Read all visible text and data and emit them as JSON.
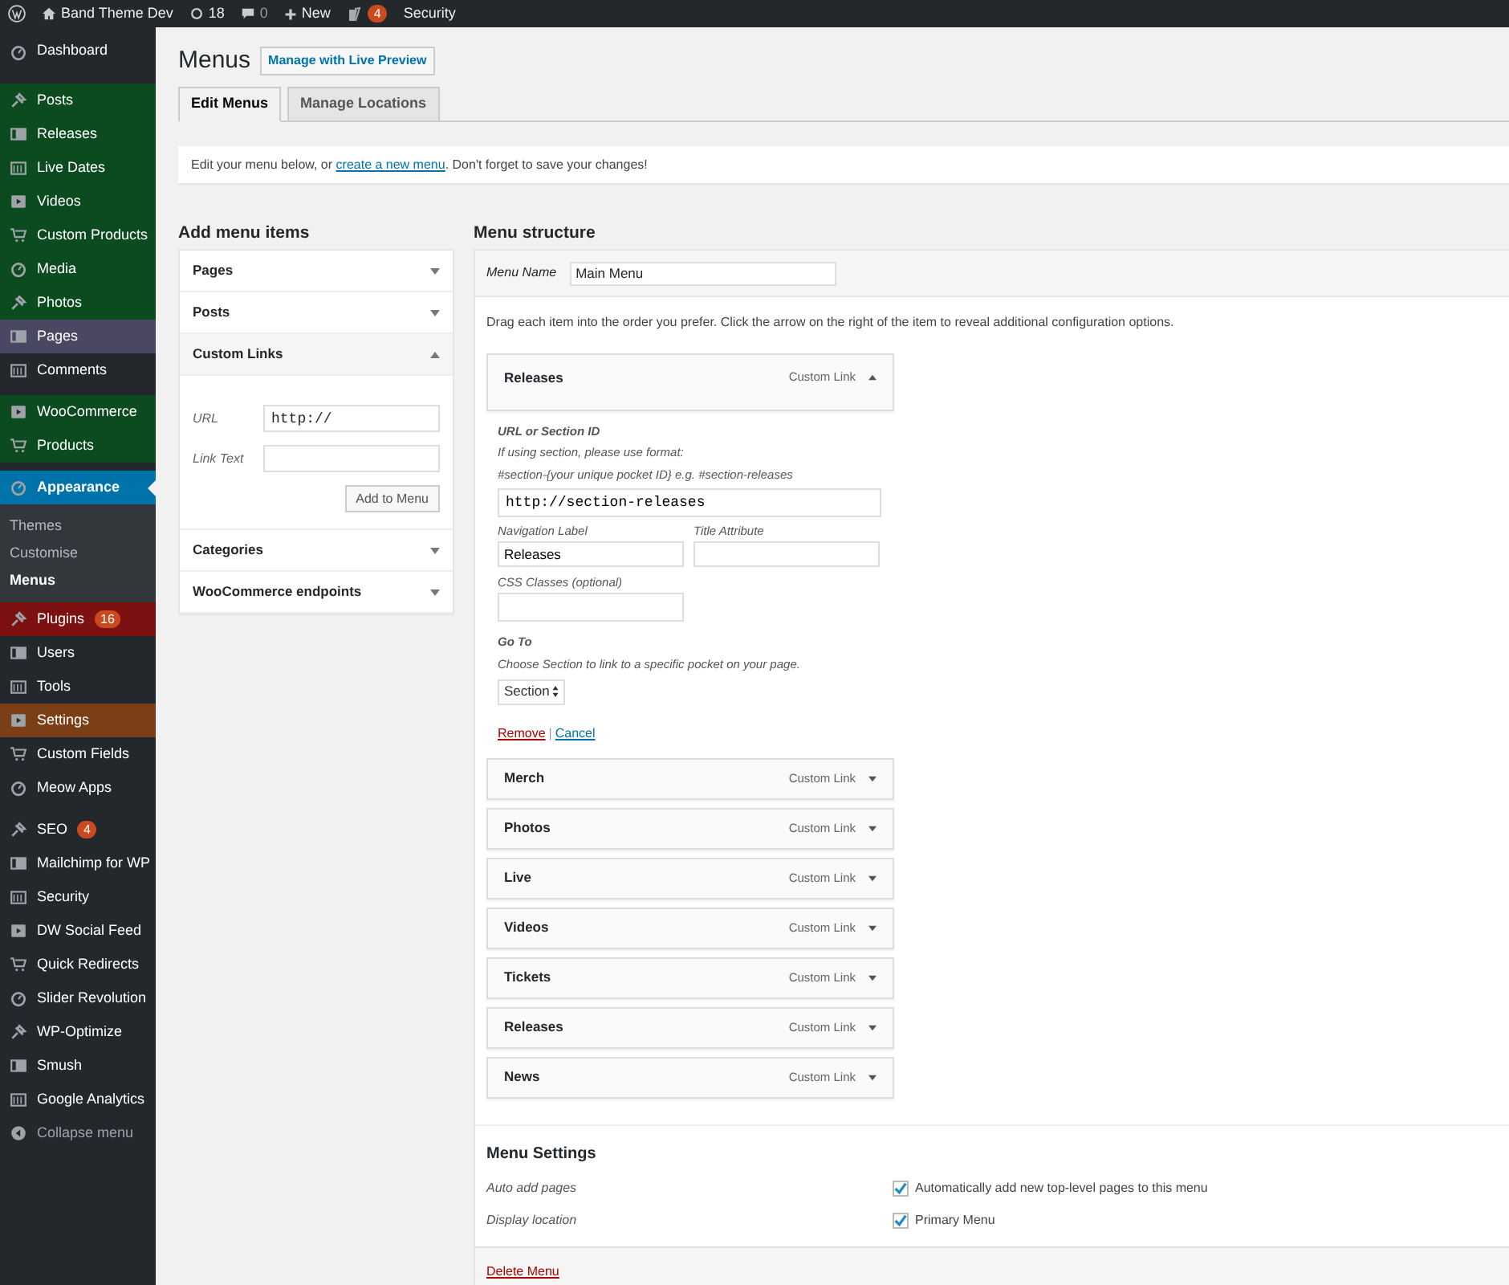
{
  "admin_bar": {
    "site_name": "Band Theme Dev",
    "updates": "18",
    "comments": "0",
    "new_label": "New",
    "seo_badge": "4",
    "security": "Security"
  },
  "sidebar": {
    "groups": [
      [
        {
          "label": "Dashboard",
          "color": "#23282d",
          "selected": false
        }
      ],
      [
        {
          "label": "Posts",
          "color": "#0c4a1f",
          "selected": false
        },
        {
          "label": "Releases",
          "color": "#0c4a1f",
          "selected": false
        },
        {
          "label": "Live Dates",
          "color": "#0c4a1f",
          "selected": false
        },
        {
          "label": "Videos",
          "color": "#0c4a1f",
          "selected": false
        },
        {
          "label": "Custom Products",
          "color": "#0c4a1f",
          "selected": false
        },
        {
          "label": "Media",
          "color": "#0c4a1f",
          "selected": false
        },
        {
          "label": "Photos",
          "color": "#0c4a1f",
          "selected": false
        },
        {
          "label": "Pages",
          "color": "#4a4763",
          "selected": false
        },
        {
          "label": "Comments",
          "color": "#23282d",
          "selected": false
        }
      ],
      [
        {
          "label": "WooCommerce",
          "color": "#0c4a1f",
          "selected": false
        },
        {
          "label": "Products",
          "color": "#0c4a1f",
          "selected": false
        }
      ],
      [
        {
          "label": "Appearance",
          "color": "#0073aa",
          "selected": true,
          "children": [
            {
              "label": "Themes",
              "selected": false
            },
            {
              "label": "Customise",
              "selected": false
            },
            {
              "label": "Menus",
              "selected": true
            }
          ]
        },
        {
          "label": "Plugins",
          "color": "#7d1010",
          "selected": false,
          "badge": "16"
        },
        {
          "label": "Users",
          "color": "#23282d",
          "selected": false
        },
        {
          "label": "Tools",
          "color": "#23282d",
          "selected": false
        },
        {
          "label": "Settings",
          "color": "#7b3f17",
          "selected": false
        },
        {
          "label": "Custom Fields",
          "color": "#23282d",
          "selected": false
        },
        {
          "label": "Meow Apps",
          "color": "#23282d",
          "selected": false
        }
      ],
      [
        {
          "label": "SEO",
          "color": "#23282d",
          "selected": false,
          "badge": "4"
        },
        {
          "label": "Mailchimp for WP",
          "color": "#23282d",
          "selected": false
        },
        {
          "label": "Security",
          "color": "#23282d",
          "selected": false
        },
        {
          "label": "DW Social Feed",
          "color": "#23282d",
          "selected": false
        },
        {
          "label": "Quick Redirects",
          "color": "#23282d",
          "selected": false
        },
        {
          "label": "Slider Revolution",
          "color": "#23282d",
          "selected": false
        },
        {
          "label": "WP-Optimize",
          "color": "#23282d",
          "selected": false
        },
        {
          "label": "Smush",
          "color": "#23282d",
          "selected": false
        },
        {
          "label": "Google Analytics",
          "color": "#23282d",
          "selected": false
        }
      ]
    ],
    "collapse": "Collapse menu"
  },
  "page": {
    "title": "Menus",
    "live_preview_button": "Manage with Live Preview",
    "tabs": [
      {
        "label": "Edit Menus",
        "selected": true
      },
      {
        "label": "Manage Locations",
        "selected": false
      }
    ],
    "notice": {
      "before": "Edit your menu below, or ",
      "link": "create a new menu",
      "after": ". Don't forget to save your changes!"
    }
  },
  "add_menu_items": {
    "title": "Add menu items",
    "sections": [
      {
        "title": "Pages",
        "expanded": false
      },
      {
        "title": "Posts",
        "expanded": false
      },
      {
        "title": "Custom Links",
        "expanded": true,
        "fields": [
          {
            "label": "URL",
            "value": "http://"
          },
          {
            "label": "Link Text"
          }
        ],
        "button": "Add to Menu"
      },
      {
        "title": "Categories",
        "expanded": false
      },
      {
        "title": "WooCommerce endpoints",
        "expanded": false
      }
    ]
  },
  "menu_structure": {
    "title": "Menu structure",
    "menu_name_label": "Menu Name",
    "menu_name_value": "Main Menu",
    "instructions": "Drag each item into the order you prefer. Click the arrow on the right of the item to reveal additional configuration options.",
    "items": [
      {
        "label": "Releases",
        "type": "Custom Link",
        "expanded": true,
        "details": {
          "url_label": "URL or Section ID",
          "help_lines": [
            "If using section, please use format:",
            "#section-{your unique pocket ID} e.g. #section-releases"
          ],
          "url_value": "http://section-releases",
          "nav_label": "Navigation Label",
          "nav_value": "Releases",
          "title_label": "Title Attribute",
          "css_label": "CSS Classes (optional)",
          "goto_label": "Go To",
          "goto_help": "Choose Section to link to a specific pocket on your page.",
          "select_value": "Section",
          "remove": "Remove",
          "separator": "|",
          "cancel": "Cancel"
        }
      },
      {
        "label": "Merch",
        "type": "Custom Link",
        "expanded": false
      },
      {
        "label": "Photos",
        "type": "Custom Link",
        "expanded": false
      },
      {
        "label": "Live",
        "type": "Custom Link",
        "expanded": false
      },
      {
        "label": "Videos",
        "type": "Custom Link",
        "expanded": false
      },
      {
        "label": "Tickets",
        "type": "Custom Link",
        "expanded": false
      },
      {
        "label": "Releases",
        "type": "Custom Link",
        "expanded": false
      },
      {
        "label": "News",
        "type": "Custom Link",
        "expanded": false
      }
    ],
    "settings": {
      "title": "Menu Settings",
      "rows": [
        {
          "label": "Auto add pages",
          "option": "Automatically add new top-level pages to this menu",
          "checked": true
        },
        {
          "label": "Display location",
          "option": "Primary Menu",
          "checked": true
        }
      ]
    },
    "delete_link": "Delete Menu"
  }
}
